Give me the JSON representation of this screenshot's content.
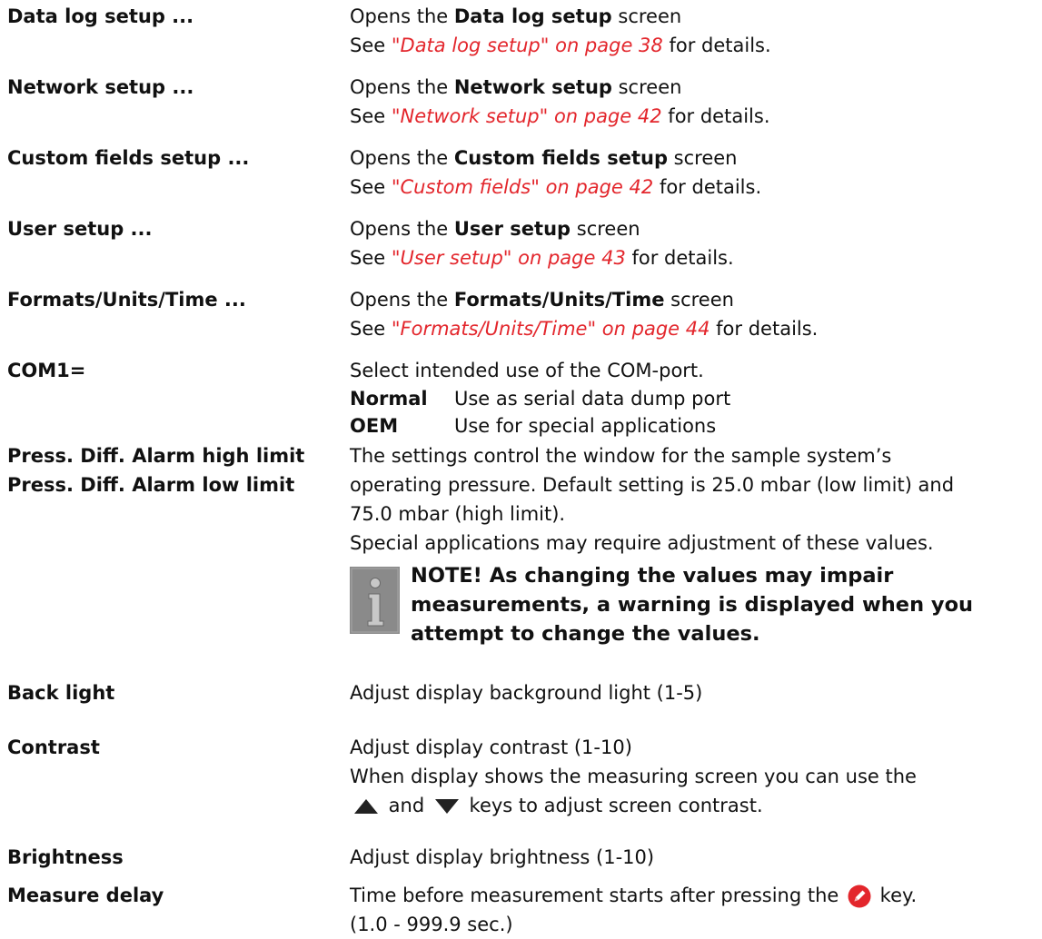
{
  "rows": [
    {
      "term": "Data log setup ...",
      "l1_pre": "Opens the ",
      "l1_bold": "Data log setup",
      "l1_post": " screen",
      "l2_pre": "See ",
      "ref": "\"Data log setup\" on page 38",
      "l2_post": " for details."
    },
    {
      "term": "Network setup ...",
      "l1_pre": "Opens the ",
      "l1_bold": "Network setup",
      "l1_post": " screen",
      "l2_pre": "See ",
      "ref": "\"Network setup\" on page 42",
      "l2_post": " for details."
    },
    {
      "term": "Custom fields setup ...",
      "l1_pre": "Opens the ",
      "l1_bold": "Custom fields setup",
      "l1_post": " screen",
      "l2_pre": "See ",
      "ref": "\"Custom fields\" on page 42",
      "l2_post": " for details."
    },
    {
      "term": "User setup ...",
      "l1_pre": "Opens the ",
      "l1_bold": "User setup",
      "l1_post": " screen",
      "l2_pre": "See ",
      "ref": "\"User setup\" on page 43",
      "l2_post": " for details."
    },
    {
      "term": "Formats/Units/Time ...",
      "l1_pre": "Opens the ",
      "l1_bold": "Formats/Units/Time",
      "l1_post": " screen",
      "l2_pre": "See ",
      "ref": "\"Formats/Units/Time\" on page 44",
      "l2_post": " for details."
    }
  ],
  "com1": {
    "term": "COM1=",
    "desc": "Select intended use of the COM-port.",
    "options": [
      {
        "key": "Normal",
        "text": "Use as serial data dump port"
      },
      {
        "key": "OEM",
        "text": "Use for special applications"
      }
    ]
  },
  "press": {
    "term1": "Press. Diff. Alarm high limit",
    "term2": "Press. Diff. Alarm low limit",
    "line1": "The settings control the window for the sample system’s",
    "line2": "operating pressure. Default setting is 25.0 mbar (low limit) and",
    "line3": "75.0 mbar (high limit).",
    "line4": "Special applications may require adjustment of these values.",
    "note": "NOTE! As changing the values may impair measurements, a warning is displayed when you attempt to change the values."
  },
  "backlight": {
    "term": "Back light",
    "desc": "Adjust display background light (1-5)"
  },
  "contrast": {
    "term": "Contrast",
    "desc": "Adjust display contrast (1-10)",
    "line2": "When display shows the measuring screen you can use the",
    "and": " and ",
    "line3_post": " keys to adjust screen contrast."
  },
  "brightness": {
    "term": "Brightness",
    "desc": "Adjust display brightness (1-10)"
  },
  "measure": {
    "term": "Measure delay",
    "pre": "Time before measurement starts after pressing the ",
    "post": " key.",
    "line2": "(1.0 - 999.9 sec.)"
  },
  "colors": {
    "reference": "#e3262c",
    "note_icon": "#8a8a8a",
    "measure_key": "#e3262c"
  }
}
